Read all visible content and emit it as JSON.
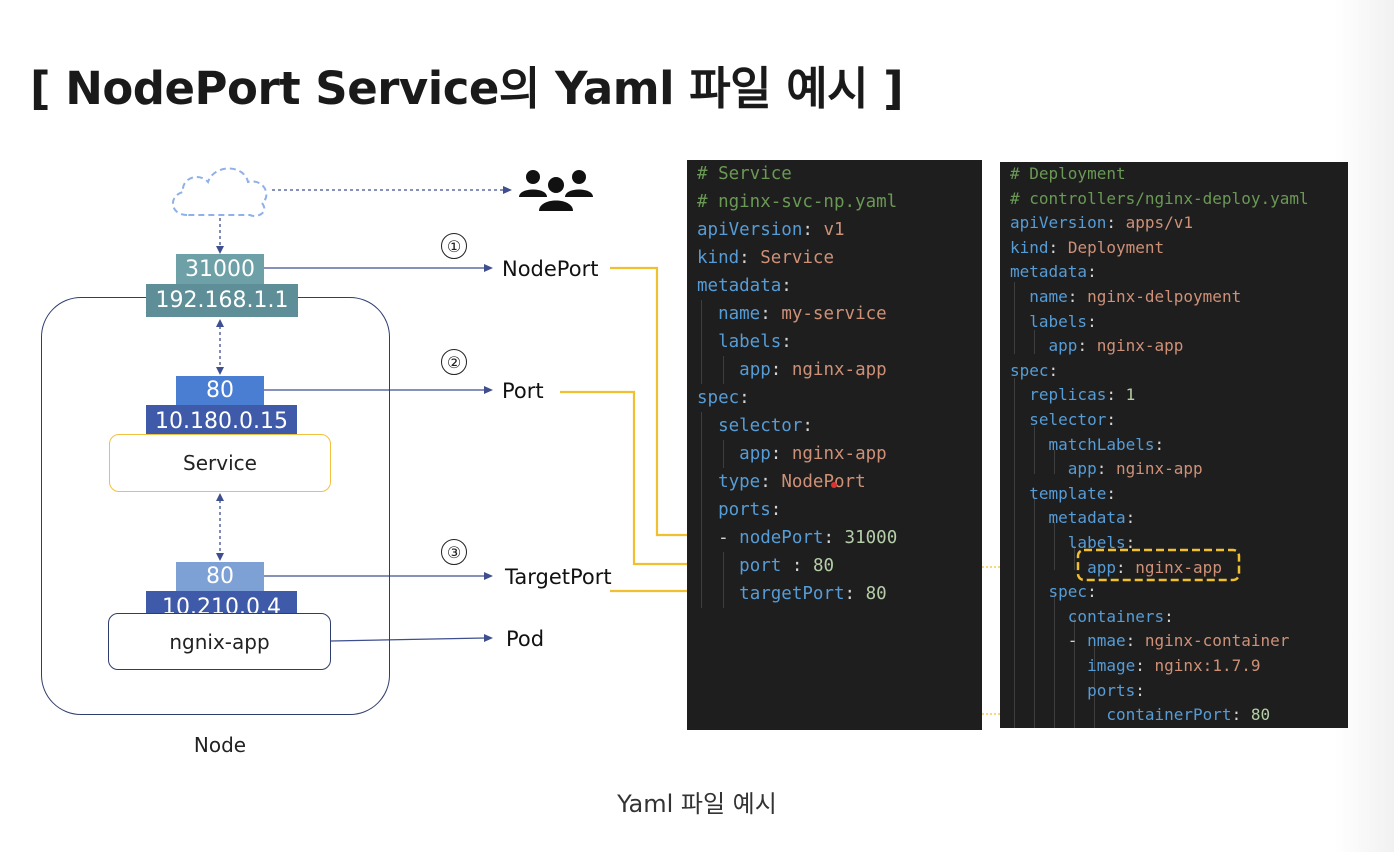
{
  "title": "[ NodePort Service의 Yaml 파일 예시 ]",
  "caption": "Yaml 파일 예시",
  "diagram": {
    "node_label": "Node",
    "node_port": "31000",
    "node_ip": "192.168.1.1",
    "service_port": "80",
    "service_ip": "10.180.0.15",
    "service_label": "Service",
    "pod_port": "80",
    "pod_ip": "10.210.0.4",
    "pod_label": "ngnix-app",
    "steps": [
      {
        "num": "①",
        "label": "NodePort"
      },
      {
        "num": "②",
        "label": "Port"
      },
      {
        "num": "③",
        "label": "TargetPort"
      },
      {
        "num": "",
        "label": "Pod"
      }
    ]
  },
  "service_yaml": [
    "# Service",
    "# nginx-svc-np.yaml",
    "apiVersion: v1",
    "kind: Service",
    "metadata:",
    "  name: my-service",
    "  labels:",
    "    app: nginx-app",
    "spec:",
    "  selector:",
    "    app: nginx-app",
    "  type: NodePort",
    "  ports:",
    "  - nodePort: 31000",
    "    port : 80",
    "    targetPort: 80"
  ],
  "deployment_yaml": [
    "# Deployment",
    "# controllers/nginx-deploy.yaml",
    "apiVersion: apps/v1",
    "kind: Deployment",
    "metadata:",
    "  name: nginx-delpoyment",
    "  labels:",
    "    app: nginx-app",
    "spec:",
    "  replicas: 1",
    "  selector:",
    "    matchLabels:",
    "      app: nginx-app",
    "  template:",
    "    metadata:",
    "      labels:",
    "        app: nginx-app",
    "    spec:",
    "      containers:",
    "      - nmae: nginx-container",
    "        image: nginx:1.7.9",
    "        ports:",
    "          containerPort: 80"
  ],
  "colors": {
    "code_bg": "#1e1e1e",
    "comment": "#6a9955",
    "key": "#569cd6",
    "string": "#ce9178",
    "number": "#b5cea8",
    "arrow_yellow": "#f0c030",
    "arrow_blue": "#3e4e8e"
  },
  "icons": {
    "cloud": "cloud-icon",
    "users": "users-icon"
  }
}
